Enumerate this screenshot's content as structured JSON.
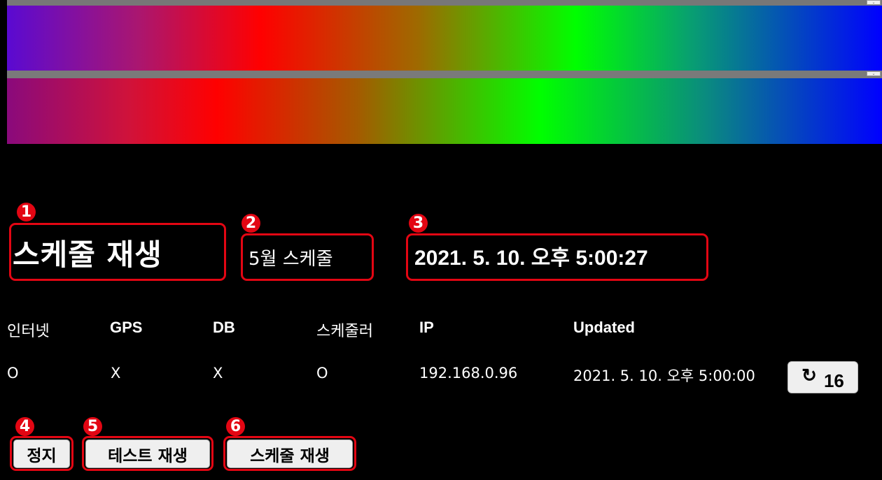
{
  "header": {
    "title": "스케줄 재생",
    "schedule_month": "5월 스케줄",
    "current_datetime": "2021. 5. 10. 오후 5:00:27"
  },
  "markers": [
    "1",
    "2",
    "3",
    "4",
    "5",
    "6"
  ],
  "status_table": {
    "columns": [
      "인터넷",
      "GPS",
      "DB",
      "스케줄러",
      "IP",
      "Updated"
    ],
    "row": {
      "internet": "O",
      "gps": "X",
      "db": "X",
      "scheduler": "O",
      "ip": "192.168.0.96",
      "updated": "2021. 5. 10. 오후 5:00:00"
    }
  },
  "refresh_button": {
    "icon": "refresh-icon",
    "glyph": "↻",
    "count": "16"
  },
  "controls": {
    "stop_label": "정지",
    "test_play_label": "테스트 재생",
    "schedule_play_label": "스케줄 재생"
  },
  "colors": {
    "highlight": "#e30613",
    "background": "#000000",
    "button_bg": "#efefef"
  }
}
